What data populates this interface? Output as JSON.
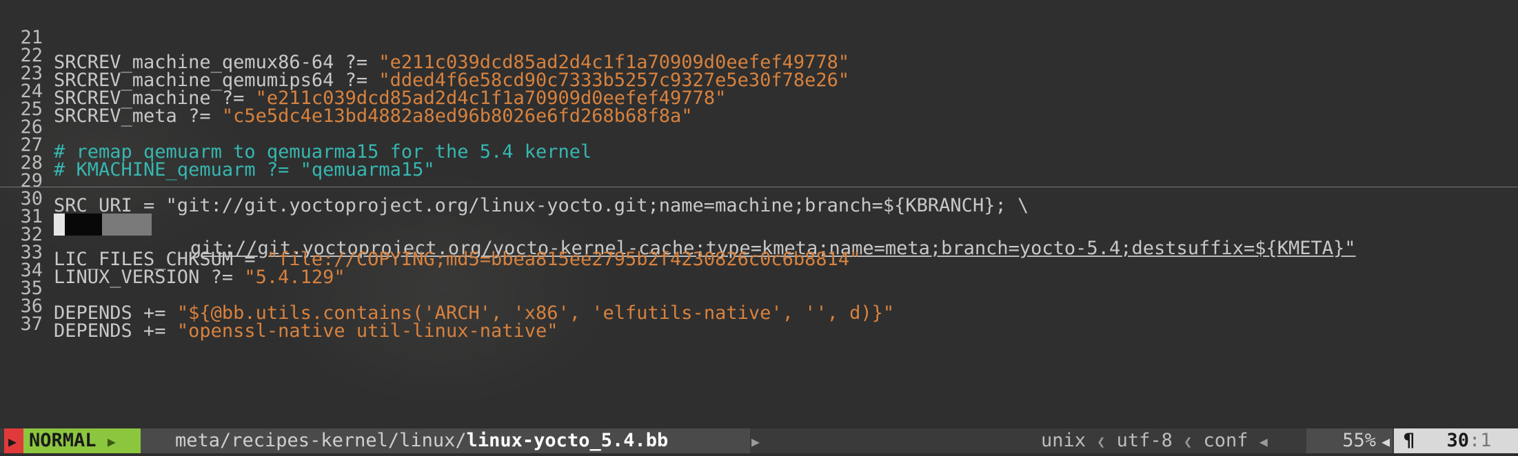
{
  "lines": [
    {
      "num": "21",
      "pre": "SRCREV_machine_qemux86-64 ?= ",
      "str": "\"e211c039dcd85ad2d4c1f1a70909d0eefef49778\""
    },
    {
      "num": "22",
      "pre": "SRCREV_machine_qemumips64 ?= ",
      "str": "\"dded4f6e58cd90c7333b5257c9327e5e30f78e26\""
    },
    {
      "num": "23",
      "pre": "SRCREV_machine ?= ",
      "str": "\"e211c039dcd85ad2d4c1f1a70909d0eefef49778\""
    },
    {
      "num": "24",
      "pre": "SRCREV_meta ?= ",
      "str": "\"c5e5dc4e13bd4882a8ed96b8026e6fd268b68f8a\""
    },
    {
      "num": "25"
    },
    {
      "num": "26",
      "cmt": "# remap qemuarm to qemuarma15 for the 5.4 kernel"
    },
    {
      "num": "27",
      "cmt": "# KMACHINE_qemuarm ?= \"qemuarma15\""
    },
    {
      "num": "28"
    },
    {
      "num": "29",
      "pre": "SRC_URI = \"git://git.yoctoproject.org/linux-yocto.git;name=machine;branch=${KBRANCH}; \\"
    },
    {
      "num": "30",
      "pre": "git://git.yoctoproject.org/yocto-kernel-cache;type=kmeta;name=meta;branch=yocto-5.4;destsuffix=${KMETA}\""
    },
    {
      "num": "31"
    },
    {
      "num": "32",
      "pre": "LIC_FILES_CHKSUM = ",
      "str": "\"file://COPYING;md5=bbea815ee2795b2f4230826c0c6b8814\""
    },
    {
      "num": "33",
      "pre": "LINUX_VERSION ?= ",
      "str": "\"5.4.129\""
    },
    {
      "num": "34"
    },
    {
      "num": "35",
      "pre": "DEPENDS += ",
      "str": "\"${@bb.utils.contains('ARCH', 'x86', 'elfutils-native', '', d)}\""
    },
    {
      "num": "36",
      "pre": "DEPENDS += ",
      "str": "\"openssl-native util-linux-native\""
    },
    {
      "num": "37"
    }
  ],
  "status": {
    "mode": "NORMAL",
    "path_dir": "meta/recipes-kernel/linux/",
    "path_file": "linux-yocto_5.4.bb",
    "fileformat": "unix",
    "encoding": "utf-8",
    "filetype": "conf",
    "percent": "55%",
    "line": "30",
    "col": ":1"
  }
}
